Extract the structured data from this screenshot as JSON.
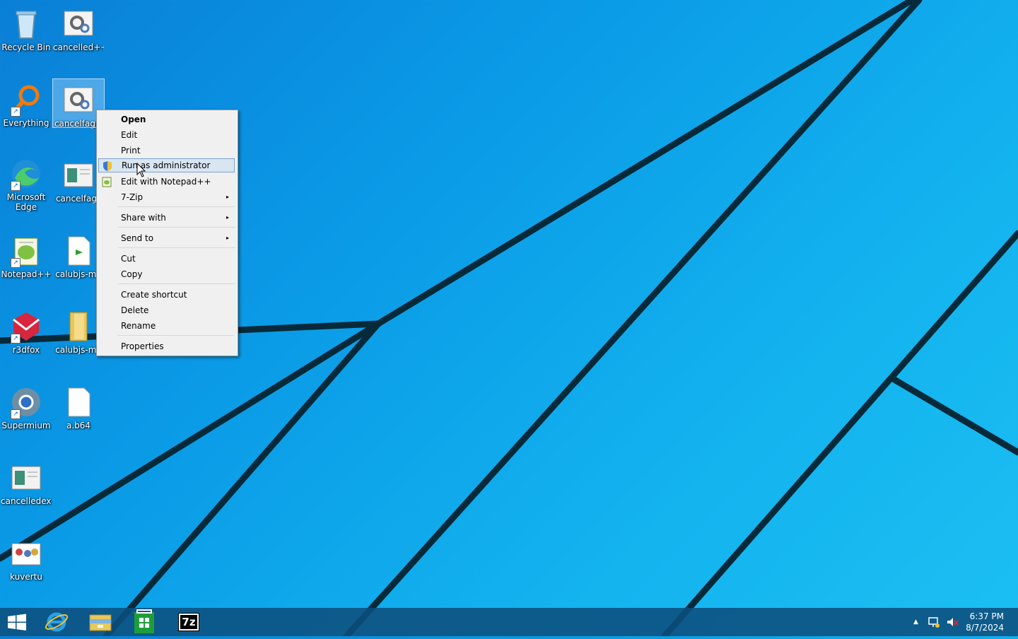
{
  "desktop": {
    "icons": [
      {
        "label": "Recycle Bin"
      },
      {
        "label": "cancelled++"
      },
      {
        "label": "Everything"
      },
      {
        "label": "cancelfag+"
      },
      {
        "label": "Microsoft Edge"
      },
      {
        "label": "cancelfag_"
      },
      {
        "label": "Notepad++"
      },
      {
        "label": "calubjs-ma"
      },
      {
        "label": "r3dfox"
      },
      {
        "label": "calubjs-ma"
      },
      {
        "label": "Supermium"
      },
      {
        "label": "a.b64"
      },
      {
        "label": "cancelledexe"
      },
      {
        "label": "kuvertu"
      }
    ]
  },
  "context_menu": {
    "items": [
      {
        "label": "Open"
      },
      {
        "label": "Edit"
      },
      {
        "label": "Print"
      },
      {
        "label": "Run as administrator"
      },
      {
        "label": "Edit with Notepad++"
      },
      {
        "label": "7-Zip"
      },
      {
        "label": "Share with"
      },
      {
        "label": "Send to"
      },
      {
        "label": "Cut"
      },
      {
        "label": "Copy"
      },
      {
        "label": "Create shortcut"
      },
      {
        "label": "Delete"
      },
      {
        "label": "Rename"
      },
      {
        "label": "Properties"
      }
    ],
    "submenu_arrow": "▸"
  },
  "taskbar": {
    "clock_time": "6:37 PM",
    "clock_date": "8/7/2024",
    "tray_chevron": "▲",
    "seven_zip_label": "7z"
  },
  "colors": {
    "menu_hover": "#d8e6f2",
    "taskbar": "#0c4e7d",
    "wallpaper_accent": "#0a9ae6"
  }
}
